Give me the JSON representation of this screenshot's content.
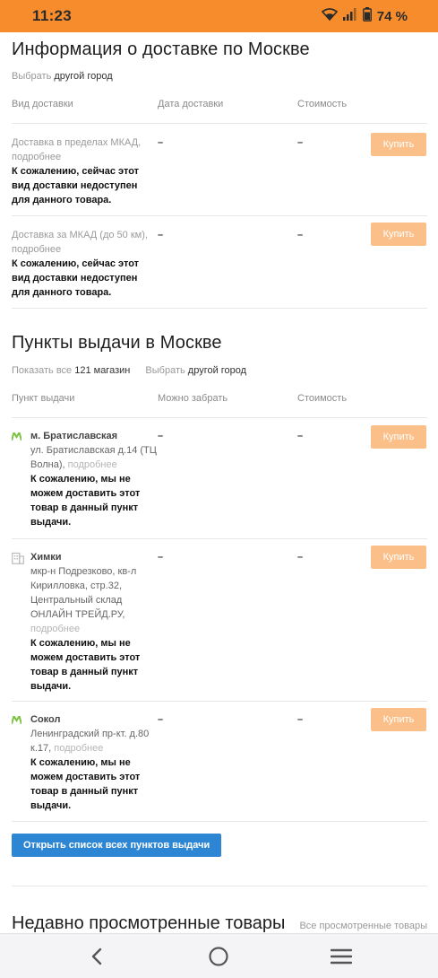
{
  "status": {
    "time": "11:23",
    "battery": "74 %",
    "icons": [
      "wifi-icon",
      "signal-icon",
      "battery-icon"
    ]
  },
  "delivery": {
    "title": "Информация о доставке по Москве",
    "choose_label": "Выбрать",
    "choose_link": "другой город",
    "headers": [
      "Вид доставки",
      "Дата доставки",
      "Стоимость"
    ],
    "rows": [
      {
        "name": "Доставка в пределах МКАД,",
        "more": "подробнее",
        "notice": "К сожалению, сейчас этот вид доставки недоступен для данного товара.",
        "date": "–",
        "cost": "–",
        "button": "Купить"
      },
      {
        "name": "Доставка за МКАД (до 50 км),",
        "more": "подробнее",
        "notice": "К сожалению, сейчас этот вид доставки недоступен для данного товара.",
        "date": "–",
        "cost": "–",
        "button": "Купить"
      }
    ]
  },
  "pickup": {
    "title": "Пункты выдачи в Москве",
    "show_all_label": "Показать все",
    "show_all_count": "121 магазин",
    "choose_label": "Выбрать",
    "choose_link": "другой город",
    "headers": [
      "Пункт выдачи",
      "Можно забрать",
      "Стоимость"
    ],
    "rows": [
      {
        "icon": "metro-icon",
        "name": "м. Братиславская",
        "address": "ул. Братиславская д.14 (ТЦ Волна),",
        "more": "подробнее",
        "notice": "К сожалению, мы не можем доставить этот товар в данный пункт выдачи.",
        "date": "–",
        "cost": "–",
        "button": "Купить"
      },
      {
        "icon": "building-icon",
        "name": "Химки",
        "address": "мкр-н Подрезково, кв-л Кирилловка, стр.32, Центральный склад ОНЛАЙН ТРЕЙД.РУ,",
        "more": "подробнее",
        "notice": "К сожалению, мы не можем доставить этот товар в данный пункт выдачи.",
        "date": "–",
        "cost": "–",
        "button": "Купить"
      },
      {
        "icon": "metro-icon",
        "name": "Сокол",
        "address": "Ленинградский пр-кт. д.80 к.17,",
        "more": "подробнее",
        "notice": "К сожалению, мы не можем доставить этот товар в данный пункт выдачи.",
        "date": "–",
        "cost": "–",
        "button": "Купить"
      }
    ],
    "open_list_button": "Открыть список всех пунктов выдачи"
  },
  "recent": {
    "title": "Недавно просмотренные товары",
    "all_link": "Все просмотренные товары"
  },
  "colors": {
    "status_bar": "#f68c2c",
    "buy_button": "#fbc08a",
    "primary_button": "#2d86d4",
    "metro_icon": "#7cc242"
  },
  "nav": [
    "back-icon",
    "home-icon",
    "menu-icon"
  ]
}
